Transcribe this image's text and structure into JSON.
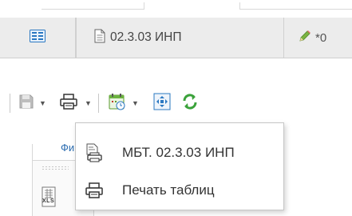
{
  "tabs": [
    {
      "label": "",
      "icon": "split-view-icon"
    },
    {
      "label": "02.3.03 ИНП",
      "icon": "document-icon"
    },
    {
      "label": "*0",
      "icon": "pencil-icon"
    }
  ],
  "toolbar": {
    "buttons": [
      {
        "name": "save",
        "icon": "save-icon",
        "has_dropdown": true
      },
      {
        "name": "print",
        "icon": "printer-icon",
        "has_dropdown": true,
        "active": true
      },
      {
        "name": "calendar",
        "icon": "calendar-icon",
        "has_dropdown": true
      },
      {
        "name": "fit",
        "icon": "fit-screen-icon",
        "has_dropdown": false
      },
      {
        "name": "refresh",
        "icon": "refresh-icon",
        "has_dropdown": false
      }
    ],
    "dropdown_glyph": "▼"
  },
  "subtab": {
    "label": "Фи"
  },
  "sidebar": {
    "file_icon_label": "XLS"
  },
  "print_menu": {
    "items": [
      {
        "label": "МБТ. 02.3.03 ИНП",
        "icon": "document-print-icon"
      },
      {
        "label": "Печать таблиц",
        "icon": "printer-icon"
      }
    ]
  },
  "colors": {
    "accent_blue": "#2b78c2",
    "refresh_green": "#3aa23a",
    "tabbar_bg": "#ececec"
  }
}
